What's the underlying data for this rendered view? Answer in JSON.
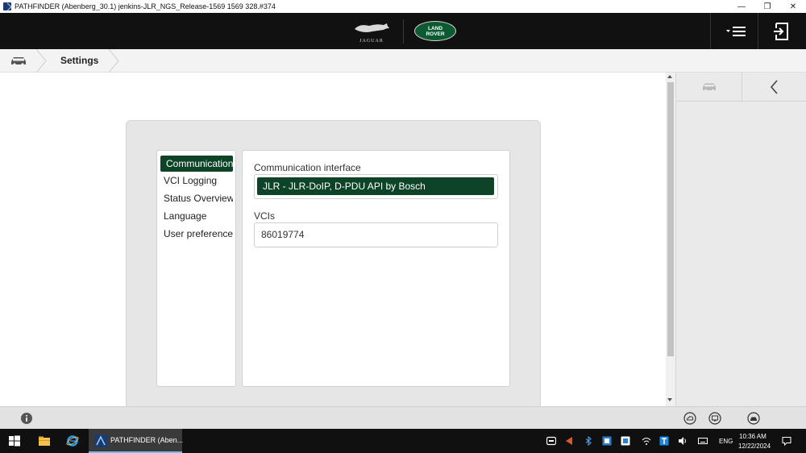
{
  "window": {
    "title": "PATHFINDER (Abenberg_30.1) jenkins-JLR_NGS_Release-1569 1569 328.#374",
    "controls": {
      "minimize": "—",
      "restore": "❐",
      "close": "✕"
    }
  },
  "header": {
    "brand_jaguar": "JAGUAR",
    "brand_landrover": "LAND\nROVER",
    "colors": {
      "header_bg": "#111111",
      "accent_green": "#0d4428"
    }
  },
  "breadcrumb": {
    "items": [
      "Settings"
    ]
  },
  "settings": {
    "nav": [
      {
        "label": "Communication",
        "active": true
      },
      {
        "label": "VCI Logging",
        "active": false
      },
      {
        "label": "Status Overview",
        "active": false
      },
      {
        "label": "Language",
        "active": false
      },
      {
        "label": "User preferences",
        "active": false
      }
    ],
    "communication_interface": {
      "label": "Communication interface",
      "value": "JLR - JLR-DoIP, D-PDU API by Bosch"
    },
    "vcis": {
      "label": "VCIs",
      "value": "86019774"
    }
  },
  "statusbar": {
    "icons": [
      "info-icon",
      "cloud-icon",
      "monitor-icon",
      "vehicle-connection-icon"
    ]
  },
  "taskbar": {
    "app_label": "PATHFINDER (Aben...",
    "language": "ENG",
    "time": "10:36 AM",
    "date": "12/22/2024"
  }
}
